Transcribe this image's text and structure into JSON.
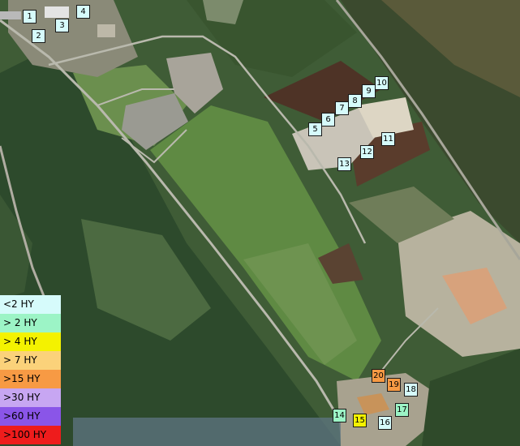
{
  "legend": [
    {
      "label": "<2 HY",
      "color": "#d6fbfb"
    },
    {
      "label": "> 2 HY",
      "color": "#9cf4c6"
    },
    {
      "label": "> 4 HY",
      "color": "#f4f200"
    },
    {
      "label": "> 7 HY",
      "color": "#fbd27a"
    },
    {
      "label": ">15 HY",
      "color": "#f79a44"
    },
    {
      "label": ">30 HY",
      "color": "#c7a6f2"
    },
    {
      "label": ">60 HY",
      "color": "#8a55e8"
    },
    {
      "label": ">100 HY",
      "color": "#ee1c1c"
    }
  ],
  "markers": [
    {
      "label": "1",
      "color": "#d6fbfb"
    },
    {
      "label": "2",
      "color": "#d6fbfb"
    },
    {
      "label": "3",
      "color": "#d6fbfb"
    },
    {
      "label": "4",
      "color": "#d6fbfb"
    },
    {
      "label": "5",
      "color": "#d6fbfb"
    },
    {
      "label": "6",
      "color": "#d6fbfb"
    },
    {
      "label": "7",
      "color": "#d6fbfb"
    },
    {
      "label": "8",
      "color": "#d6fbfb"
    },
    {
      "label": "9",
      "color": "#d6fbfb"
    },
    {
      "label": "10",
      "color": "#d6fbfb"
    },
    {
      "label": "11",
      "color": "#d6fbfb"
    },
    {
      "label": "12",
      "color": "#d6fbfb"
    },
    {
      "label": "13",
      "color": "#d6fbfb"
    },
    {
      "label": "14",
      "color": "#9cf4c6"
    },
    {
      "label": "15",
      "color": "#f4f200"
    },
    {
      "label": "16",
      "color": "#d6fbfb"
    },
    {
      "label": "17",
      "color": "#9cf4c6"
    },
    {
      "label": "18",
      "color": "#d6fbfb"
    },
    {
      "label": "19",
      "color": "#f79a44"
    },
    {
      "label": "20",
      "color": "#f79a44"
    }
  ]
}
